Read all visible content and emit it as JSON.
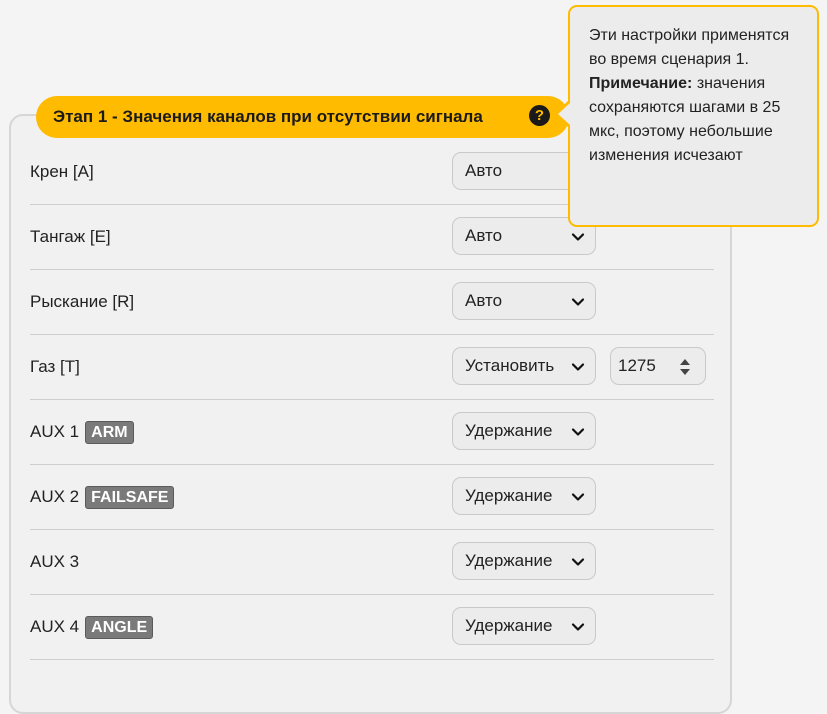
{
  "stage": {
    "title": "Этап 1 - Значения каналов при отсутствии сигнала",
    "help_glyph": "?"
  },
  "tooltip": {
    "text": "Эти настройки применятся во время сценария 1.",
    "note_label": "Примечание:",
    "note_text": "значения сохраняются шагами в 25 мкс, поэтому небольшие изменения исчезают"
  },
  "channels": [
    {
      "label": "Крен [A]",
      "badge": "",
      "mode": "Авто",
      "value": ""
    },
    {
      "label": "Тангаж [E]",
      "badge": "",
      "mode": "Авто",
      "value": ""
    },
    {
      "label": "Рыскание [R]",
      "badge": "",
      "mode": "Авто",
      "value": ""
    },
    {
      "label": "Газ [T]",
      "badge": "",
      "mode": "Установить",
      "value": "1275"
    },
    {
      "label": "AUX 1",
      "badge": "ARM",
      "mode": "Удержание",
      "value": ""
    },
    {
      "label": "AUX 2",
      "badge": "FAILSAFE",
      "mode": "Удержание",
      "value": ""
    },
    {
      "label": "AUX 3",
      "badge": "",
      "mode": "Удержание",
      "value": ""
    },
    {
      "label": "AUX 4",
      "badge": "ANGLE",
      "mode": "Удержание",
      "value": ""
    }
  ],
  "icons": {
    "help": "question-circle-icon",
    "dropdown": "chevron-down-icon",
    "spinner": "spinner-arrows-icon"
  },
  "colors": {
    "accent": "#ffbb00",
    "badge": "#7a7a7a"
  }
}
